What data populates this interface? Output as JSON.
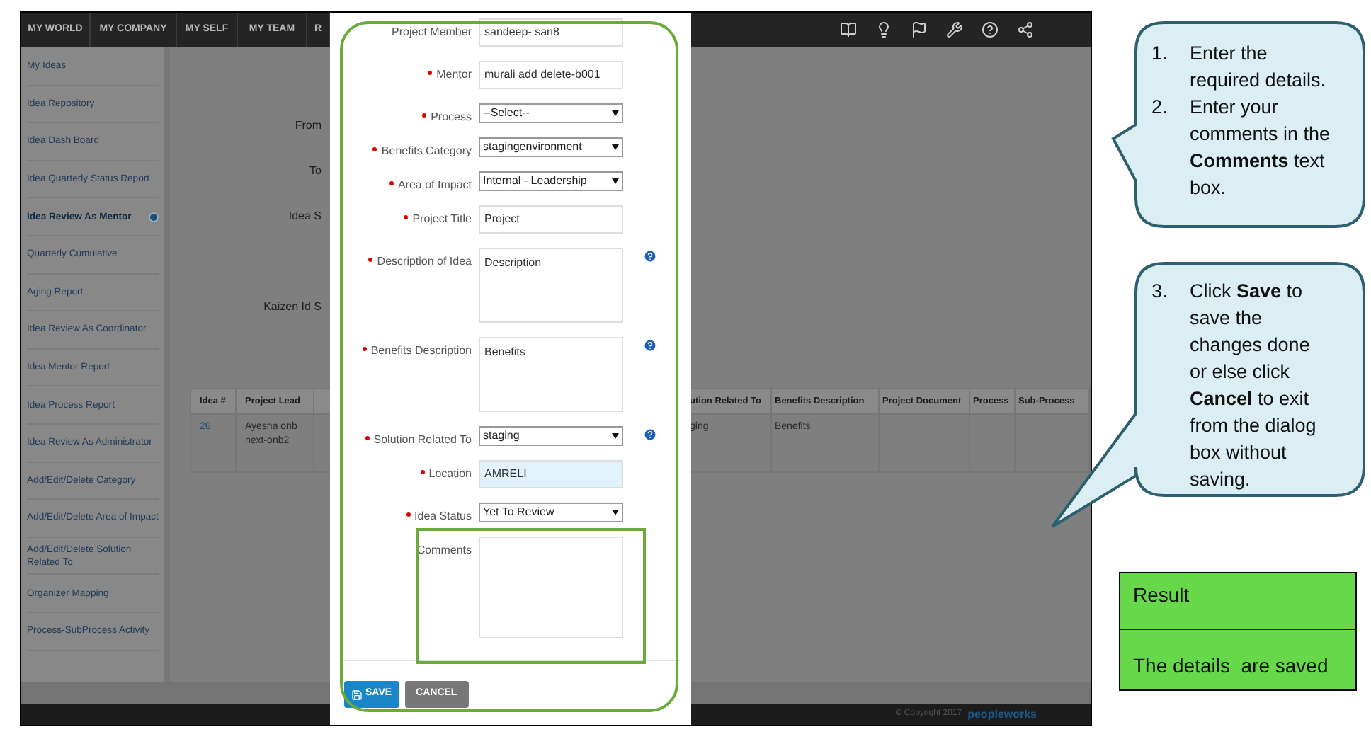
{
  "nav": {
    "items": [
      {
        "label": "MY WORLD"
      },
      {
        "label": "MY COMPANY"
      },
      {
        "label": "MY SELF"
      },
      {
        "label": "MY TEAM"
      },
      {
        "label": "R"
      }
    ],
    "icons": [
      {
        "kind": "book"
      },
      {
        "kind": "bulb"
      },
      {
        "kind": "flag"
      },
      {
        "kind": "tools"
      },
      {
        "kind": "help"
      },
      {
        "kind": "share"
      }
    ]
  },
  "sidebar": {
    "items": [
      {
        "label": "My Ideas",
        "selected": false
      },
      {
        "label": "Idea Repository",
        "selected": false
      },
      {
        "label": "Idea Dash Board",
        "selected": false
      },
      {
        "label": "Idea Quarterly Status Report",
        "selected": false
      },
      {
        "label": "Idea Review As Mentor",
        "selected": true
      },
      {
        "label": "Quarterly Cumulative",
        "selected": false
      },
      {
        "label": "Aging Report",
        "selected": false
      },
      {
        "label": "Idea Review As Coordinator",
        "selected": false
      },
      {
        "label": "Idea Mentor Report",
        "selected": false
      },
      {
        "label": "Idea Process Report",
        "selected": false
      },
      {
        "label": "Idea Review As Administrator",
        "selected": false
      },
      {
        "label": "Add/Edit/Delete Category",
        "selected": false
      },
      {
        "label": "Add/Edit/Delete Area of Impact",
        "selected": false
      },
      {
        "label": "Add/Edit/Delete Solution Related To",
        "selected": false
      },
      {
        "label": "Organizer Mapping",
        "selected": false
      },
      {
        "label": "Process-SubProcess Activity",
        "selected": false
      }
    ]
  },
  "filters": [
    "From",
    "To",
    "Idea S",
    "Kaizen Id S"
  ],
  "table": {
    "columns": [
      "Idea #",
      "Project Lead",
      "",
      "ution Related To",
      "Benefits Description",
      "Project Document",
      "Process",
      "Sub-Process"
    ],
    "rows": [
      [
        "26",
        "Ayesha onb next-onb2",
        "",
        "ging",
        "Benefits",
        "",
        "",
        ""
      ]
    ]
  },
  "dialog": {
    "fields": [
      {
        "label": "Project Member",
        "kind": "text",
        "required": false,
        "value": "sandeep- san8",
        "readonly": false
      },
      {
        "label": "Mentor",
        "kind": "text",
        "required": true,
        "value": "murali add delete-b001",
        "readonly": false
      },
      {
        "label": "Process",
        "kind": "select",
        "required": true,
        "value": "--Select--",
        "readonly": false
      },
      {
        "label": "Benefits Category",
        "kind": "select",
        "required": true,
        "value": "stagingenvironment",
        "readonly": false
      },
      {
        "label": "Area of Impact",
        "kind": "select",
        "required": true,
        "value": "Internal - Leadership",
        "readonly": false
      },
      {
        "label": "Project Title",
        "kind": "text",
        "required": true,
        "value": "Project",
        "readonly": false
      },
      {
        "label": "Description of Idea",
        "kind": "textarea",
        "required": true,
        "value": "Description",
        "help": true,
        "readonly": false
      },
      {
        "label": "Benefits Description",
        "kind": "textarea",
        "required": true,
        "value": "Benefits",
        "help": true,
        "readonly": false
      },
      {
        "label": "Solution Related To",
        "kind": "select",
        "required": true,
        "value": "staging",
        "help": true,
        "readonly": false
      },
      {
        "label": "Location",
        "kind": "text",
        "required": true,
        "value": "AMRELI",
        "readonly": true
      },
      {
        "label": "Idea Status",
        "kind": "select",
        "required": true,
        "value": "Yet To Review",
        "readonly": false
      },
      {
        "label": "Comments",
        "kind": "comments",
        "required": false,
        "readonly": false
      }
    ],
    "buttons": [
      {
        "label": "SAVE",
        "kind": "primary"
      },
      {
        "label": "CANCEL",
        "kind": "secondary"
      }
    ]
  },
  "footer": {
    "copyright": "© Copyright 2017",
    "logo": "peopleworks"
  },
  "callouts": [
    {
      "steps": [
        {
          "number": "1.",
          "text": "Enter the required details."
        },
        {
          "number": "2.",
          "text": "Enter your comments in the **Comments** text box."
        }
      ]
    },
    {
      "steps": [
        {
          "number": "3.",
          "text": "Click **Save** to save the changes done or else click **Cancel** to exit from the dialog box without saving."
        }
      ]
    }
  ],
  "result": {
    "heading": "Result",
    "text": "The details  are saved"
  }
}
